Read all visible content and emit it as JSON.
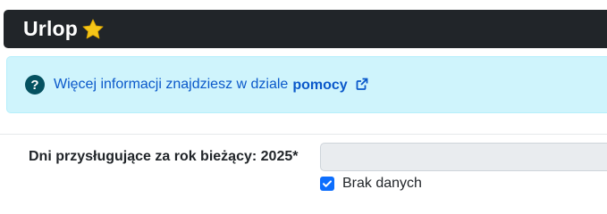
{
  "header": {
    "title": "Urlop",
    "favorite_icon": "star-icon"
  },
  "info": {
    "icon": "question-circle-icon",
    "text": "Więcej informacji znajdziesz w dziale",
    "link_label": "pomocy",
    "link_icon": "external-link-icon"
  },
  "form": {
    "days_label": "Dni przysługujące za rok bieżący: 2025*",
    "days_value": "",
    "no_data_checked": true,
    "no_data_label": "Brak danych"
  },
  "colors": {
    "header_bg": "#212529",
    "info_bg": "#cff4fc",
    "info_text": "#0a58ca",
    "checkbox_accent": "#0d6efd",
    "star": "#f5c518"
  }
}
